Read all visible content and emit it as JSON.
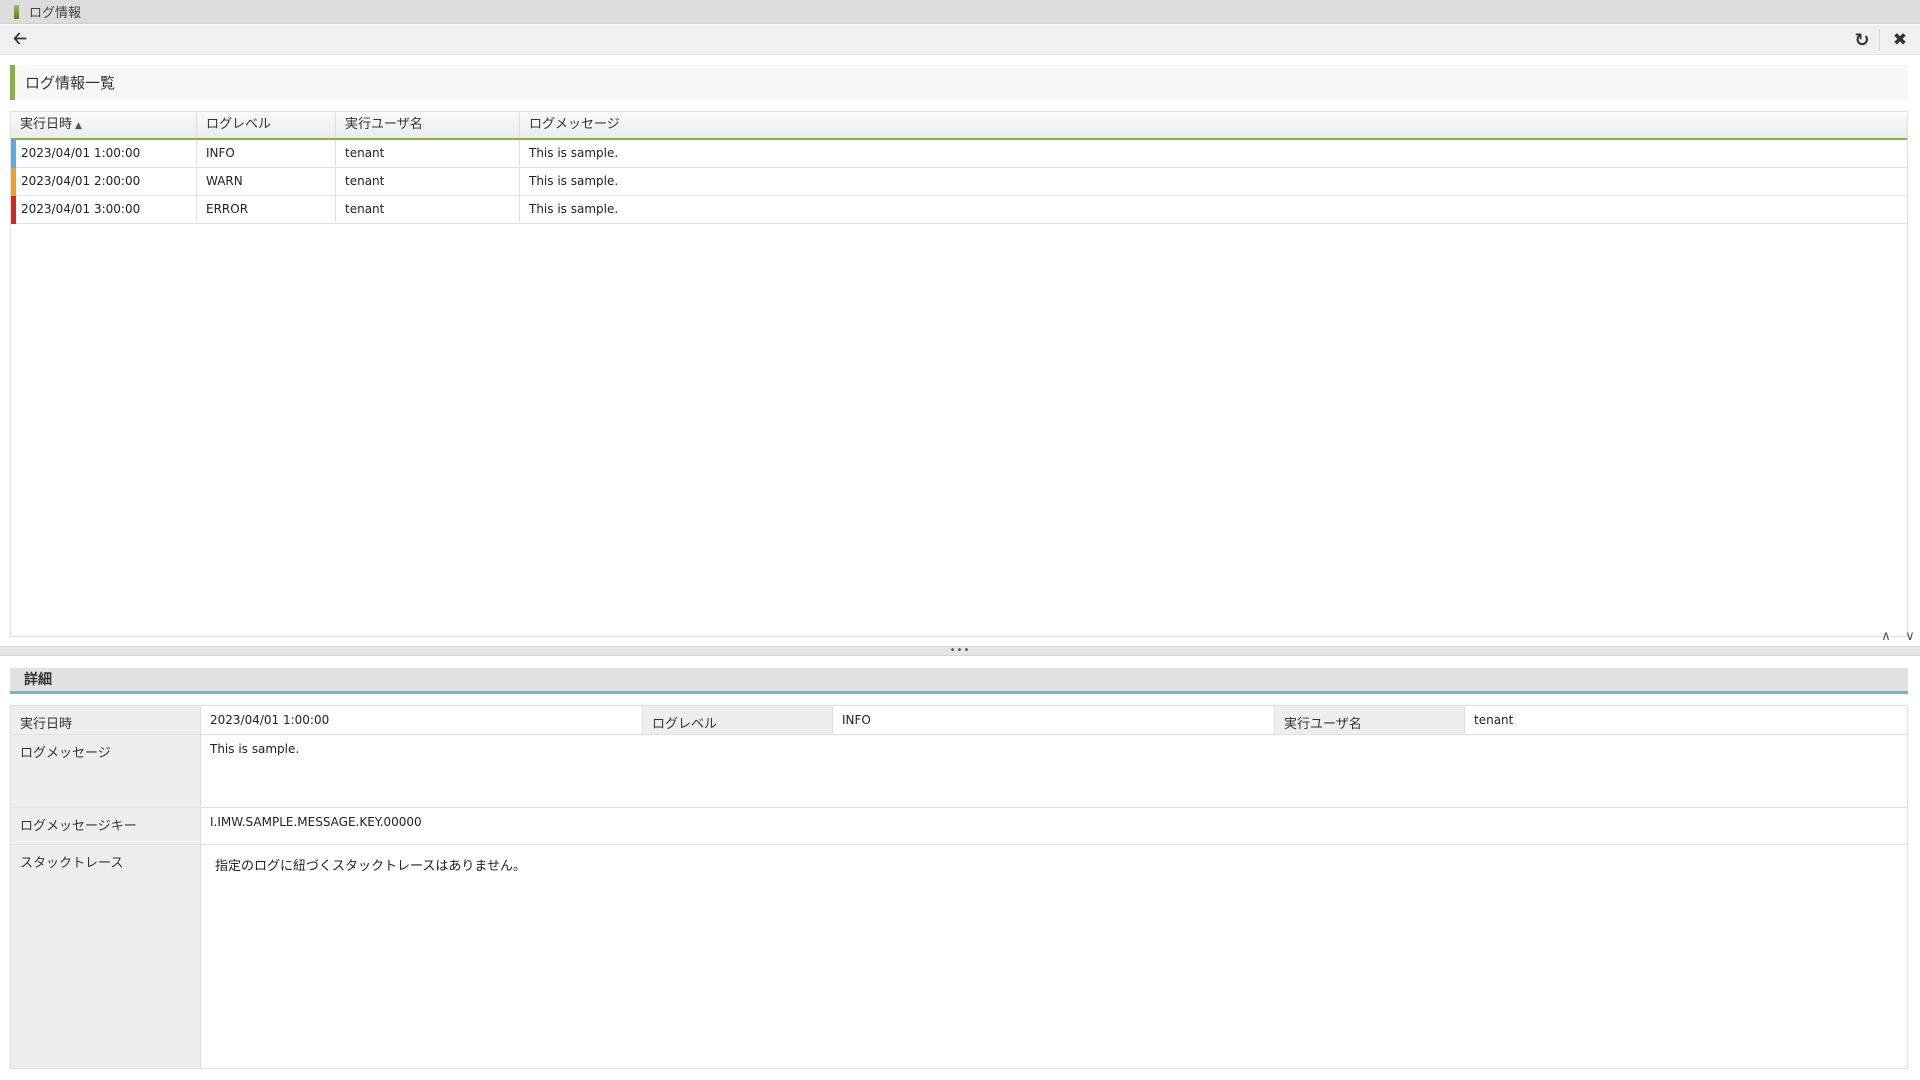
{
  "window": {
    "title": "ログ情報"
  },
  "toolbar": {
    "back_icon": "back-arrow-icon",
    "refresh_icon": "refresh-icon",
    "close_icon": "close-icon"
  },
  "list_section": {
    "title": "ログ情報一覧"
  },
  "grid": {
    "columns": [
      "実行日時",
      "ログレベル",
      "実行ユーザ名",
      "ログメッセージ"
    ],
    "sorted_column": "実行日時",
    "rows": [
      {
        "datetime": "2023/04/01 1:00:00",
        "level": "INFO",
        "user": "tenant",
        "message": "This is sample.",
        "marker_color": "#5aa9e6"
      },
      {
        "datetime": "2023/04/01 2:00:00",
        "level": "WARN",
        "user": "tenant",
        "message": "This is sample.",
        "marker_color": "#f0a020"
      },
      {
        "datetime": "2023/04/01 3:00:00",
        "level": "ERROR",
        "user": "tenant",
        "message": "This is sample.",
        "marker_color": "#d9231f"
      }
    ]
  },
  "detail_section": {
    "title": "詳細"
  },
  "detail": {
    "datetime_label": "実行日時",
    "datetime_value": "2023/04/01 1:00:00",
    "level_label": "ログレベル",
    "level_value": "INFO",
    "user_label": "実行ユーザ名",
    "user_value": "tenant",
    "message_label": "ログメッセージ",
    "message_value": "This is sample.",
    "message_key_label": "ログメッセージキー",
    "message_key_value": "I.IMW.SAMPLE.MESSAGE.KEY.00000",
    "stacktrace_label": "スタックトレース",
    "stacktrace_value": "指定のログに紐づくスタックトレースはありません。"
  },
  "colors": {
    "accent_green": "#88b04b",
    "accent_blue": "#6fb3d8"
  }
}
